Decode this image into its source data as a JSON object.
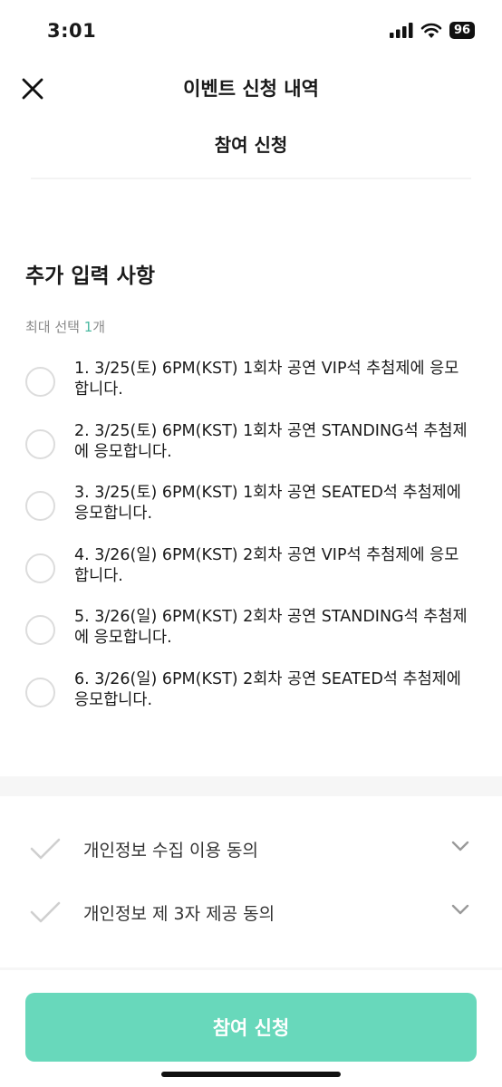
{
  "status_bar": {
    "time": "3:01",
    "battery": "96"
  },
  "header": {
    "title": "이벤트 신청 내역",
    "close_icon": "close-icon"
  },
  "subtitle": "참여 신청",
  "section": {
    "title": "추가 입력 사항",
    "max_select_prefix": "최대 선택 ",
    "max_select_count": "1",
    "max_select_suffix": "개"
  },
  "options": [
    "1. 3/25(토) 6PM(KST) 1회차 공연 VIP석 추첨제에 응모합니다.",
    "2. 3/25(토) 6PM(KST) 1회차 공연 STANDING석 추첨제에 응모합니다.",
    "3. 3/25(토) 6PM(KST) 1회차 공연 SEATED석 추첨제에 응모합니다.",
    "4. 3/26(일) 6PM(KST) 2회차 공연 VIP석 추첨제에 응모합니다.",
    "5. 3/26(일) 6PM(KST) 2회차 공연 STANDING석 추첨제에 응모합니다.",
    "6. 3/26(일) 6PM(KST) 2회차 공연 SEATED석 추첨제에 응모합니다."
  ],
  "agreements": [
    {
      "label": "개인정보 수집 이용 동의"
    },
    {
      "label": "개인정보 제 3자 제공 동의"
    }
  ],
  "submit_label": "참여 신청",
  "colors": {
    "accent": "#68d8bb",
    "accent_text": "#4ab9a1"
  }
}
